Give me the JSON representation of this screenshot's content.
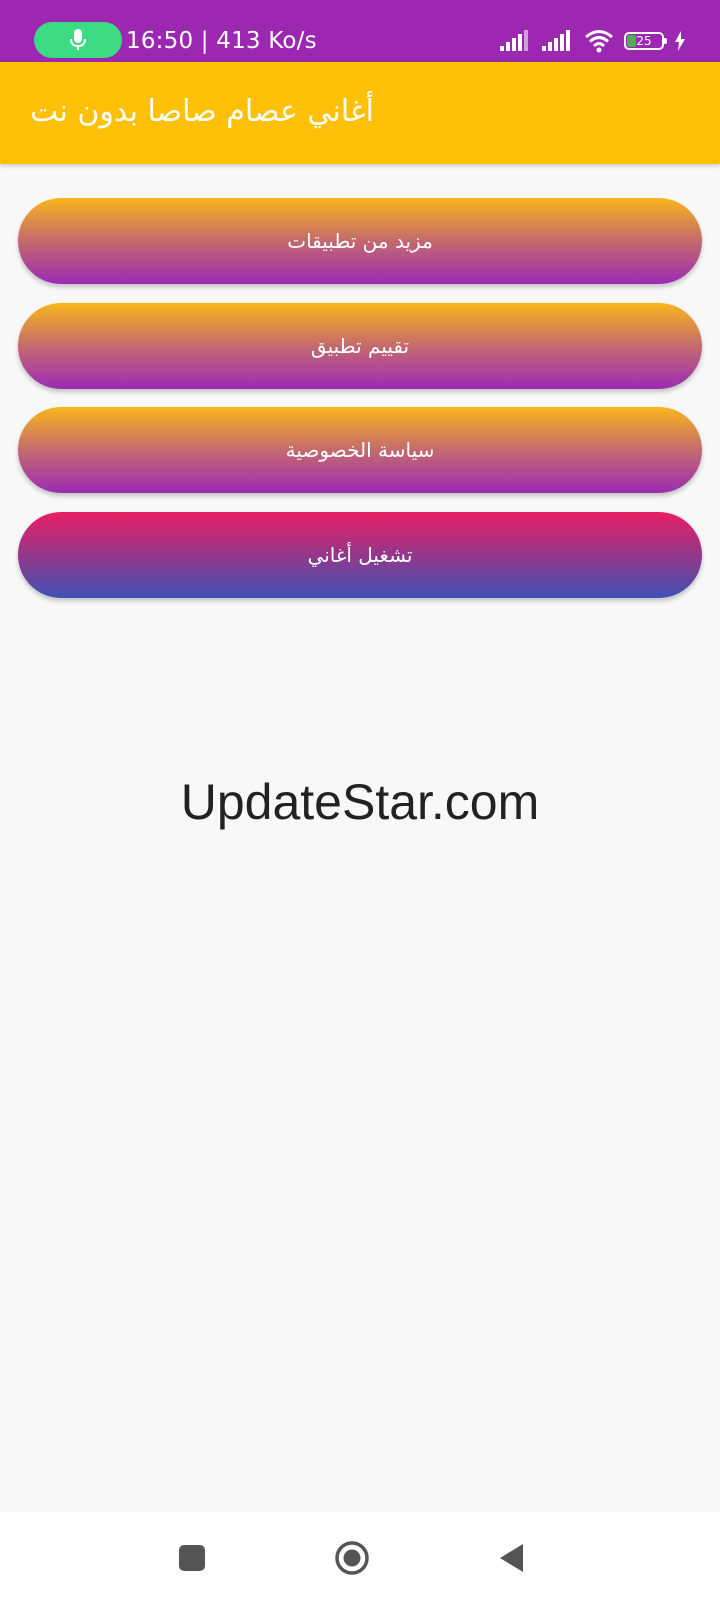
{
  "status_bar": {
    "time_speed": "16:50 | 413 Ko/s",
    "battery_level": "25",
    "battery_fraction": 0.25,
    "icons": [
      "mic-icon",
      "signal-icon",
      "signal-icon",
      "wifi-icon",
      "battery-icon",
      "charging-icon"
    ]
  },
  "app_bar": {
    "title": "أغاني عصام صاصا بدون نت"
  },
  "menu": {
    "more_apps": "مزيد من تطبيقات",
    "rate_app": "تقييم تطبيق",
    "privacy_policy": "سياسة الخصوصية",
    "play_songs": "تشغيل أغاني"
  },
  "watermark": "UpdateStar.com",
  "nav_bar": {
    "icons": [
      "recent-apps-icon",
      "home-icon",
      "back-icon"
    ]
  },
  "colors": {
    "status_bar": "#9c27b0",
    "app_bar": "#ffc107",
    "gradient_gold_top": "#f9b61c",
    "gradient_purple_bottom": "#9c2bb3",
    "gradient_pink_top": "#e91e63",
    "gradient_blue_bottom": "#3f51b5",
    "background": "#f8f8f8"
  }
}
